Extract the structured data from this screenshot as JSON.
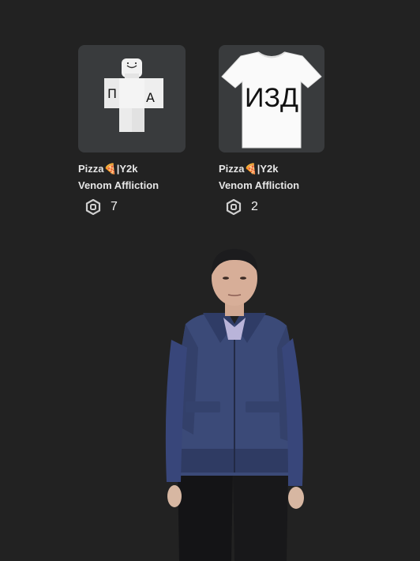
{
  "items": [
    {
      "name_line1": "Pizza🍕|Y2k",
      "name_line2": "Venom Affliction",
      "price": "7",
      "thumbnail_icon": "avatar-torso-icon",
      "torso_text_left": "П",
      "torso_text_right": "А"
    },
    {
      "name_line1": "Pizza🍕|Y2k",
      "name_line2": "Venom Affliction",
      "price": "2",
      "thumbnail_icon": "tshirt-icon",
      "shirt_text": "ИЗД"
    }
  ],
  "currency_icon": "robux-icon",
  "colors": {
    "background": "#222222",
    "thumb_bg": "#393b3d",
    "text": "#e6e6e6"
  }
}
